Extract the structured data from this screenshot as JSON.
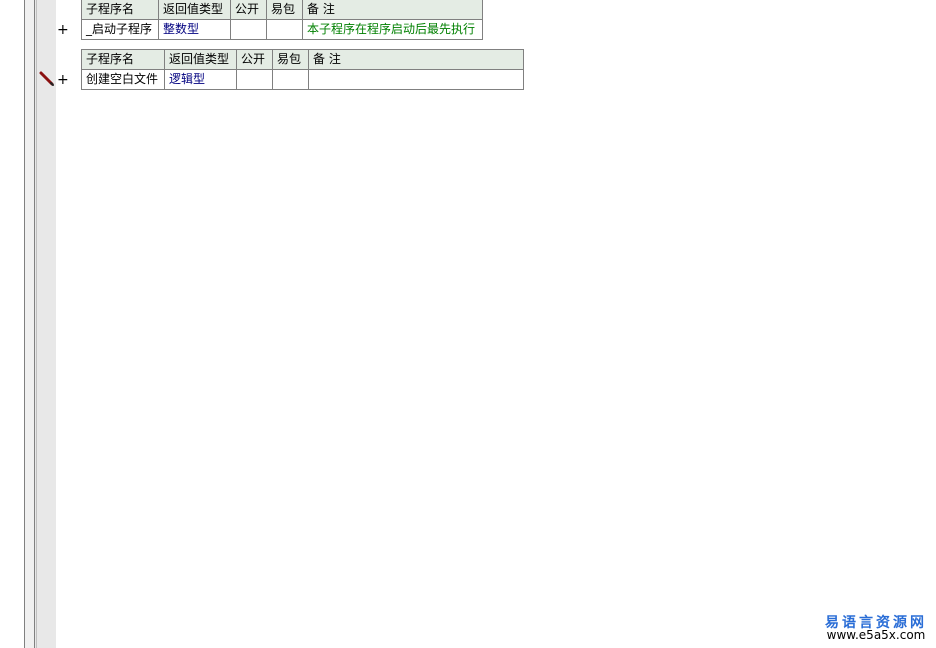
{
  "headers": {
    "name": "子程序名",
    "return_type": "返回值类型",
    "public": "公开",
    "easy_pkg": "易包",
    "note": "备 注"
  },
  "subroutines": [
    {
      "name": "_启动子程序",
      "return_type": "整数型",
      "public": "",
      "easy_pkg": "",
      "note": "本子程序在程序启动后最先执行"
    },
    {
      "name": "创建空白文件",
      "return_type": "逻辑型",
      "public": "",
      "easy_pkg": "",
      "note": ""
    }
  ],
  "gutter": {
    "expand_symbol": "+"
  },
  "watermark": {
    "line1": "易语言资源网",
    "line2": "www.e5a5x.com"
  },
  "colors": {
    "header_bg": "#e4ece4",
    "type_text": "#000080",
    "note_text": "#008000",
    "watermark_blue": "#2a6dd6"
  }
}
